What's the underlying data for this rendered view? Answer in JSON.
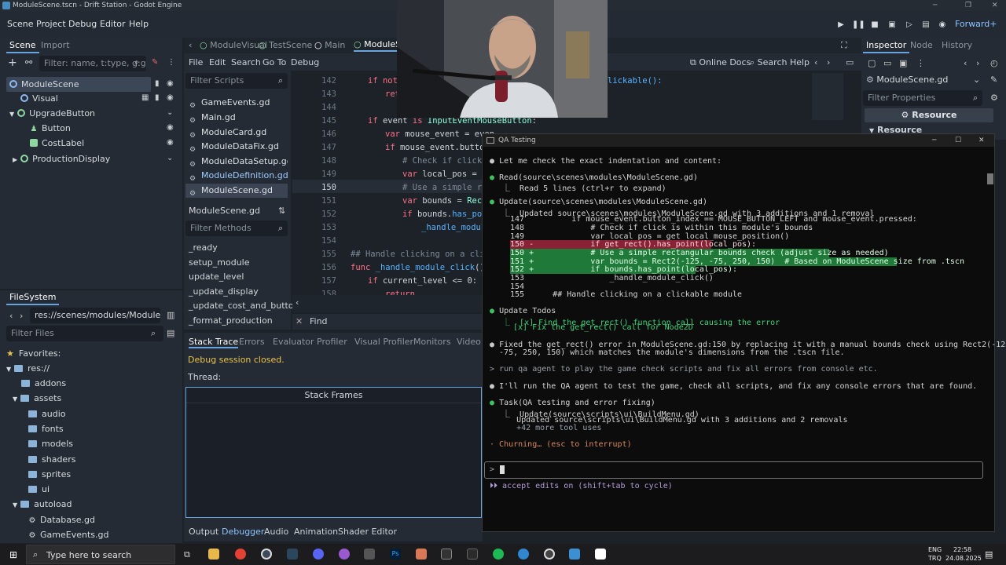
{
  "window": {
    "title": "ModuleScene.tscn - Drift Station - Godot Engine"
  },
  "menubar": {
    "items": [
      "Scene",
      "Project",
      "Debug",
      "Editor",
      "Help"
    ],
    "renderer": "Forward+"
  },
  "scene_dock": {
    "tabs": [
      "Scene",
      "Import"
    ],
    "filter_placeholder": "Filter: name, t:type, g:group",
    "tree": [
      {
        "label": "ModuleScene"
      },
      {
        "label": "Visual"
      },
      {
        "label": "UpgradeButton"
      },
      {
        "label": "Button"
      },
      {
        "label": "CostLabel"
      },
      {
        "label": "ProductionDisplay"
      }
    ]
  },
  "filesystem_dock": {
    "title": "FileSystem",
    "path": "res://scenes/modules/ModuleScene.",
    "filter_placeholder": "Filter Files",
    "items": [
      "Favorites:",
      "res://",
      "addons",
      "assets",
      "audio",
      "fonts",
      "models",
      "shaders",
      "sprites",
      "ui",
      "autoload",
      "Database.gd",
      "GameEvents.gd"
    ]
  },
  "editor_tabs": [
    "ModuleVisual",
    "TestScene",
    "Main",
    "ModuleSc"
  ],
  "script_menu": [
    "File",
    "Edit",
    "Search",
    "Go To",
    "Debug"
  ],
  "script_toolbar": {
    "online_docs": "Online Docs",
    "search_help": "Search Help"
  },
  "script_panel": {
    "filter_placeholder": "Filter Scripts",
    "scripts": [
      "GameEvents.gd",
      "Main.gd",
      "ModuleCard.gd",
      "ModuleDataFix.gd",
      "ModuleDataSetup.gd",
      "ModuleDefinition.gd",
      "ModuleScene.gd"
    ],
    "current": "ModuleScene.gd",
    "methods_placeholder": "Filter Methods",
    "methods": [
      "_ready",
      "setup_module",
      "update_level",
      "_update_display",
      "_update_cost_and_button",
      "_format_production"
    ]
  },
  "code": {
    "lines": [
      {
        "n": "142",
        "t": "if not "
      },
      {
        "n": "143",
        "t": "    ret"
      },
      {
        "n": "144",
        "t": ""
      },
      {
        "n": "145",
        "t": "if event is InputEventMouseButton:"
      },
      {
        "n": "146",
        "t": "    var mouse_event = even"
      },
      {
        "n": "147",
        "t": "    if mouse_event.button_"
      },
      {
        "n": "148",
        "t": "        # Check if click i"
      },
      {
        "n": "149",
        "t": "        var local_pos = ge"
      },
      {
        "n": "150",
        "t": "        # Use a simple rec"
      },
      {
        "n": "151",
        "t": "        var bounds = Rect2"
      },
      {
        "n": "152",
        "t": "        if bounds.has_poin"
      },
      {
        "n": "153",
        "t": "            _handle_module"
      },
      {
        "n": "154",
        "t": ""
      },
      {
        "n": "155",
        "t": "## Handle clicking on a clicka"
      },
      {
        "n": "156",
        "t": "func _handle_module_click() ->"
      },
      {
        "n": "157",
        "t": "    if current_level <= 0:"
      },
      {
        "n": "158",
        "t": "        return"
      }
    ],
    "fragment_right": "lickable():",
    "find_label": "Find"
  },
  "debugger": {
    "tabs": [
      "Stack Trace",
      "Errors",
      "Evaluator",
      "Profiler",
      "Visual Profiler",
      "Monitors",
      "Video R"
    ],
    "status": "Debug session closed.",
    "thread_label": "Thread:",
    "stack_frames": "Stack Frames"
  },
  "bottom_tabs": [
    "Output",
    "Debugger",
    "Audio",
    "Animation",
    "Shader Editor"
  ],
  "inspector": {
    "tabs": [
      "Inspector",
      "Node",
      "History"
    ],
    "object": "ModuleScene.gd",
    "filter_placeholder": "Filter Properties",
    "resource_button": "Resource",
    "section": "Resource"
  },
  "terminal": {
    "title": "QA Testing",
    "lines": [
      "Let me check the exact indentation and content:",
      "Read(source\\scenes\\modules\\ModuleScene.gd)",
      "Read 5 lines (ctrl+r to expand)",
      "Update(source\\scenes\\modules\\ModuleScene.gd)",
      "Updated source\\scenes\\modules\\ModuleScene.gd with 3 additions and 1 removal",
      "147          if mouse_event.button_index == MOUSE_BUTTON_LEFT and mouse_event.pressed:",
      "148              # Check if click is within this module's bounds",
      "149              var local_pos = get_local_mouse_position()",
      "150 -            if get_rect().has_point(local_pos):",
      "150 +            # Use a simple rectangular bounds check (adjust size as needed)",
      "151 +            var bounds = Rect2(-125, -75, 250, 150)  # Based on ModuleScene size from .tscn",
      "152 +            if bounds.has_point(local_pos):",
      "153                  _handle_module_click()",
      "154",
      "155      ## Handle clicking on a clickable module",
      "Update Todos",
      "[x] Find the get_rect() function call causing the error",
      "[x] Fix the get_rect() call for Node2D",
      "Fixed the get_rect() error in ModuleScene.gd:150 by replacing it with a manual bounds check using Rect2(-125,",
      "-75, 250, 150) which matches the module's dimensions from the .tscn file.",
      "run qa agent to play the game check scripts and fix all errors from console etc.",
      "I'll run the QA agent to test the game, check all scripts, and fix any console errors that are found.",
      "Task(QA testing and error fixing)",
      "Update(source\\scripts\\ui\\BuildMenu.gd)",
      "Updated source\\scripts\\ui\\BuildMenu.gd with 3 additions and 2 removals",
      "+42 more tool uses",
      "Churning… (esc to interrupt)",
      "accept edits on (shift+tab to cycle)"
    ]
  },
  "taskbar": {
    "search_placeholder": "Type here to search",
    "lang": "ENG",
    "layout": "TRQ",
    "time": "22:58",
    "date": "24.08.2025"
  }
}
